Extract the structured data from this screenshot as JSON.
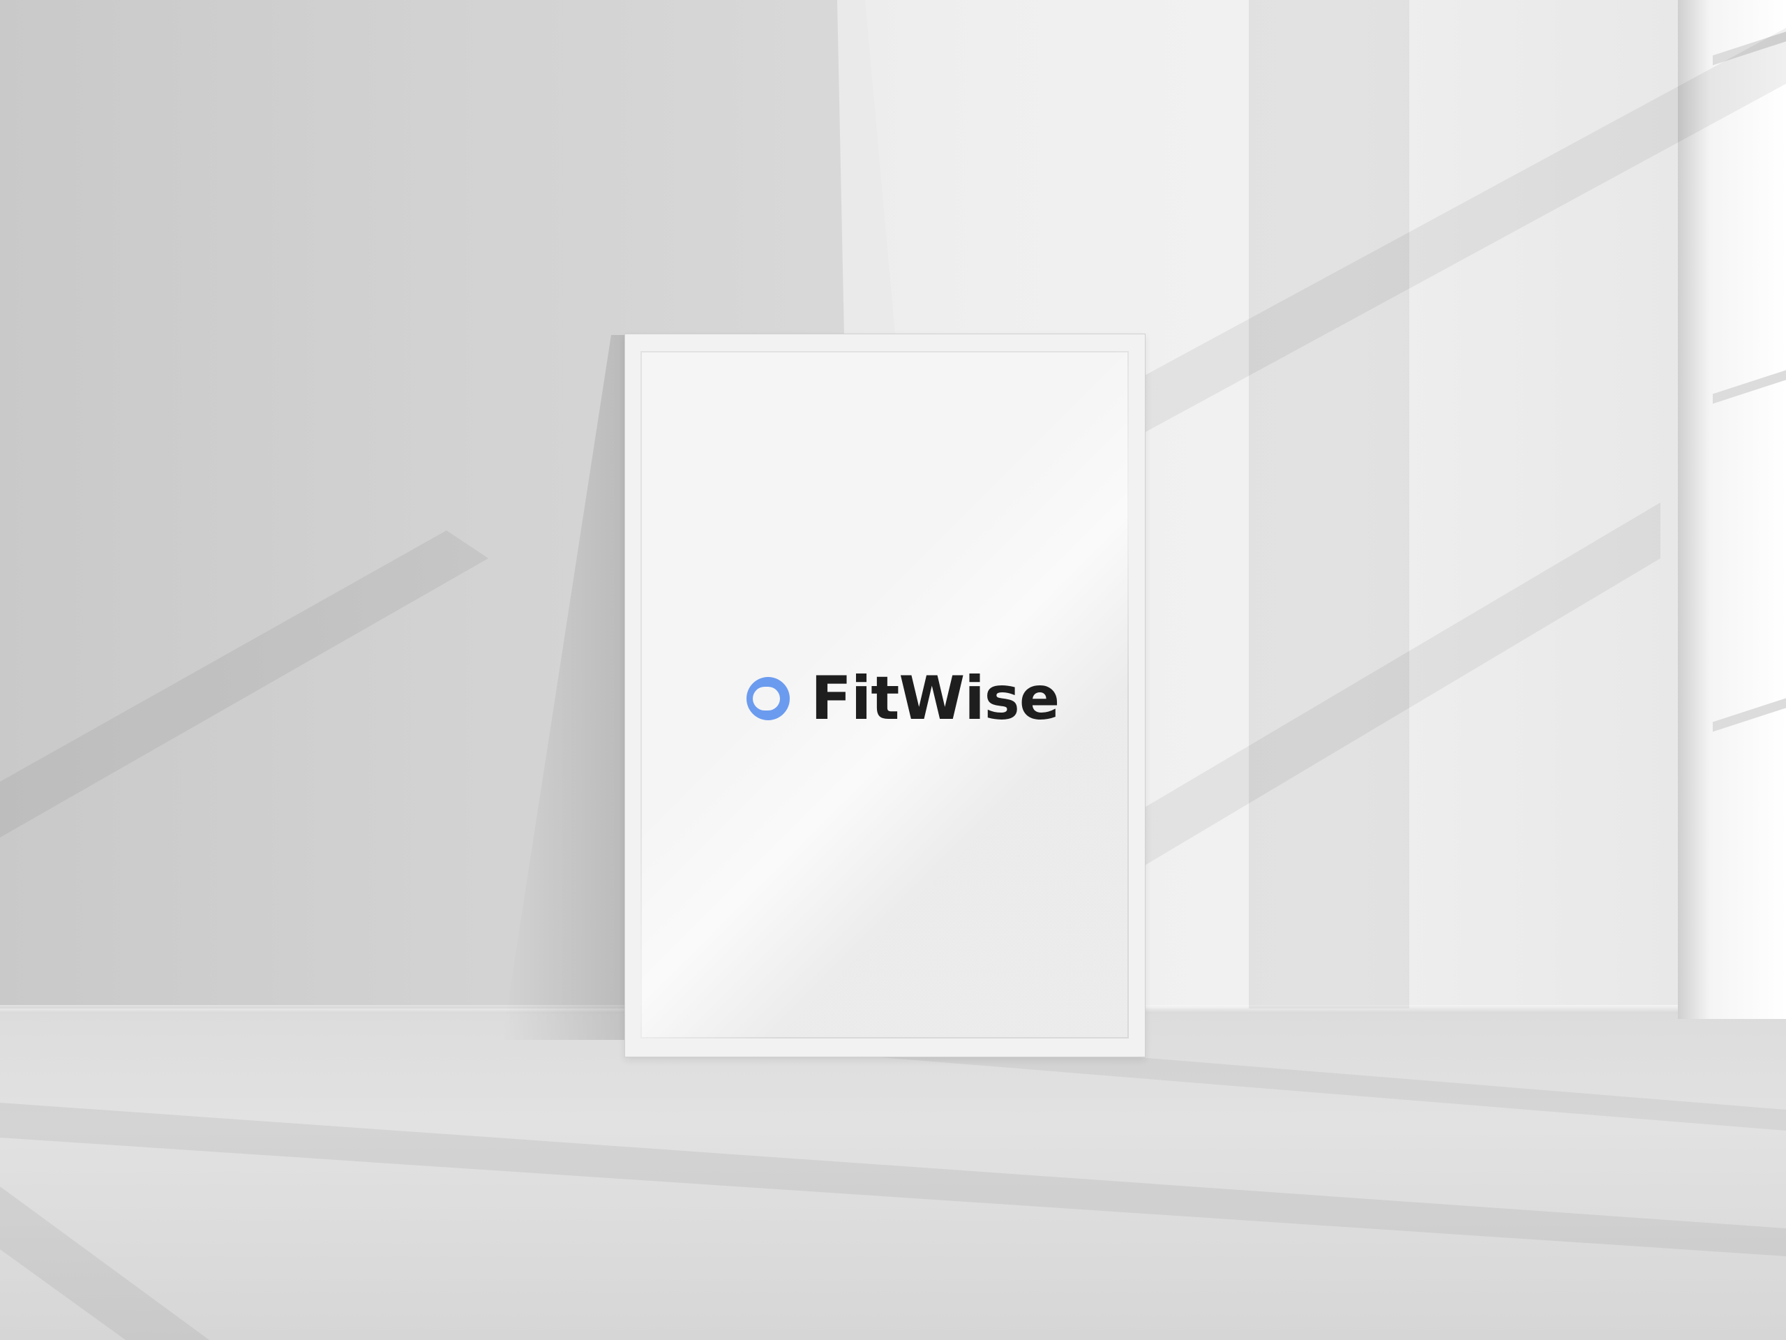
{
  "poster": {
    "brand_name": "FitWise",
    "logo_icon": "blue-circle-logo-icon",
    "colors": {
      "logo_mark": "#6b9bef",
      "wordmark": "#1e1e1e"
    }
  }
}
